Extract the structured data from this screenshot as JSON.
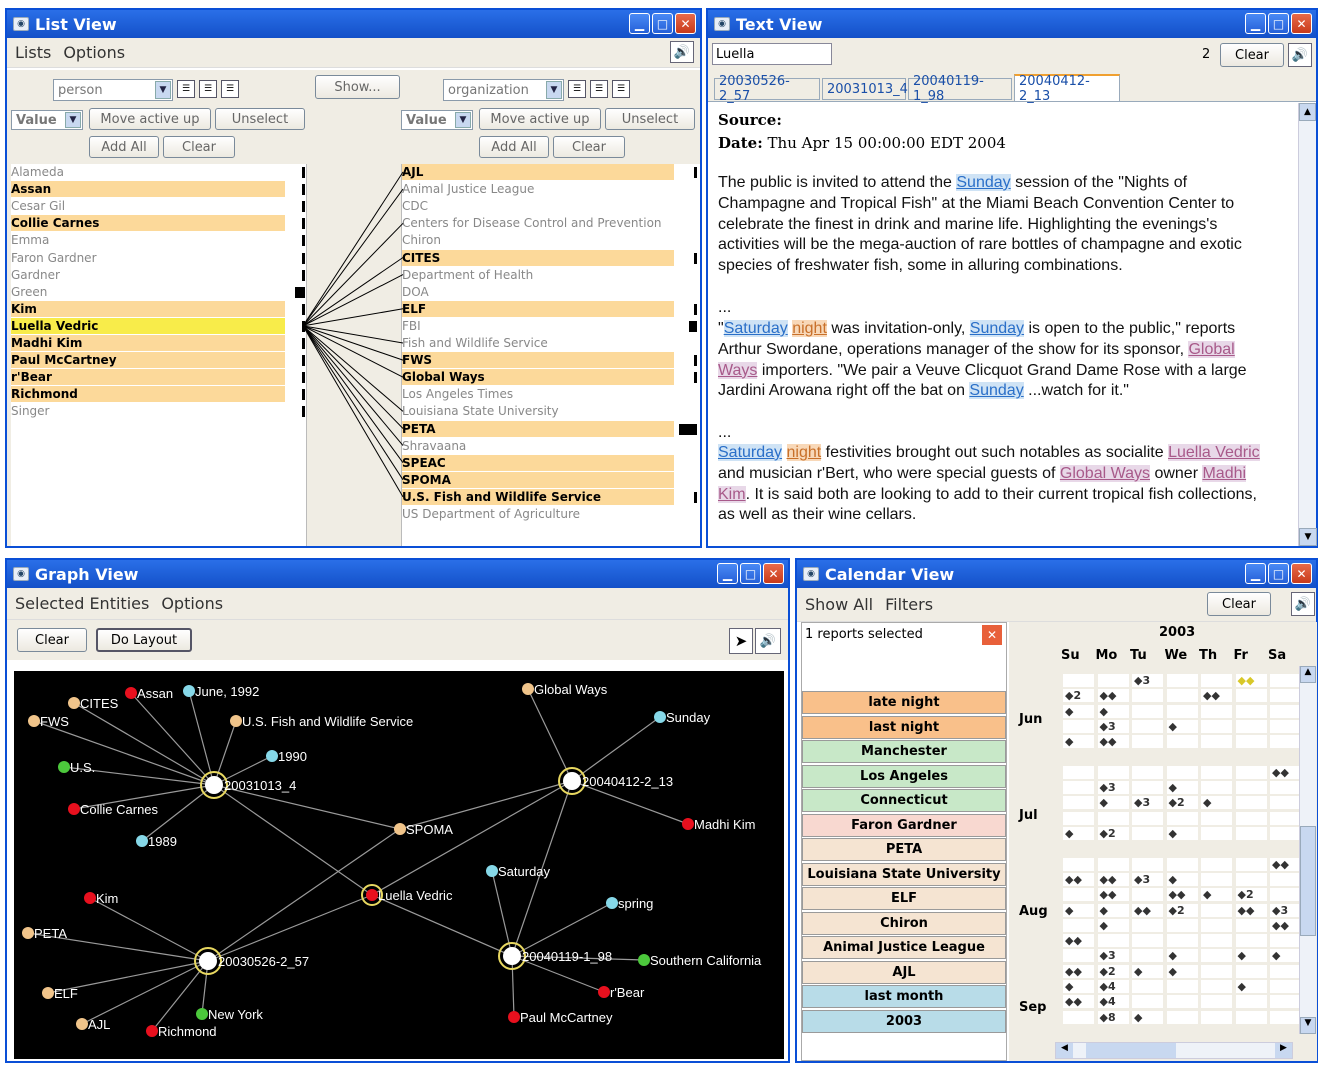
{
  "list_view": {
    "title": "List View",
    "menu": [
      "Lists",
      "Options"
    ],
    "show_button": "Show...",
    "left": {
      "type": "person",
      "value": "Value",
      "move": "Move active up",
      "unselect": "Unselect",
      "add_all": "Add All",
      "clear": "Clear",
      "items": [
        "Alameda",
        "Assan",
        "Cesar Gil",
        "Collie Carnes",
        "Emma",
        "Faron Gardner",
        "Gardner",
        "Green",
        "Kim",
        "Luella Vedric",
        "Madhi Kim",
        "Paul McCartney",
        "r'Bear",
        "Richmond",
        "Singer"
      ]
    },
    "right": {
      "type": "organization",
      "value": "Value",
      "move": "Move active up",
      "unselect": "Unselect",
      "add_all": "Add All",
      "clear": "Clear",
      "items": [
        "AJL",
        "Animal Justice League",
        "CDC",
        "Centers for Disease Control and Prevention",
        "Chiron",
        "CITES",
        "Department of Health",
        "DOA",
        "ELF",
        "FBI",
        "Fish and Wildlife Service",
        "FWS",
        "Global Ways",
        "Los Angeles Times",
        "Louisiana State University",
        "PETA",
        "Shravaana",
        "SPEAC",
        "SPOMA",
        "U.S. Fish and Wildlife Service",
        "US Department of Agriculture"
      ]
    }
  },
  "text_view": {
    "title": "Text View",
    "search": "Luella",
    "count": "2",
    "clear": "Clear",
    "tabs": [
      "20030526-2_57",
      "20031013_4",
      "20040119-1_98",
      "20040412-2_13"
    ],
    "source_label": "Source:",
    "date_label": "Date:",
    "date_value": "Thu Apr 15 00:00:00 EDT 2004",
    "p1": [
      "The public is invited to attend the ",
      "Sunday",
      " session of the \"Nights of Champagne and Tropical Fish\" at the Miami Beach Convention Center to celebrate the finest in drink and marine life. Highlighting the evenings's activities will be the mega-auction of rare bottles of champagne and exotic species of freshwater fish, some in alluring combinations."
    ],
    "ellipsis": "...",
    "p2": [
      "\"",
      "Saturday",
      " ",
      "night",
      " was invitation-only, ",
      "Sunday",
      " is open to the public,\" reports Arthur Swordane, operations manager of the show for its sponsor, ",
      "Global Ways",
      " importers. \"We pair a Veuve Clicquot Grand Dame Rose with a large Jardini Arowana right off the bat on ",
      "Sunday",
      " ...watch for it.\""
    ],
    "p3": [
      "Saturday",
      " ",
      "night",
      " festivities brought out such notables as socialite ",
      "Luella Vedric",
      " and musician r'Bert, who were special guests of ",
      "Global Ways",
      " owner ",
      "Madhi Kim",
      ". It is said both are looking to add to their current tropical fish collections, as well as their wine cellars."
    ]
  },
  "graph_view": {
    "title": "Graph View",
    "menu": [
      "Selected Entities",
      "Options"
    ],
    "clear": "Clear",
    "do_layout": "Do Layout",
    "colors": {
      "person": "#e8101e",
      "org": "#f0c48a",
      "date": "#86d8e8",
      "place": "#4cc83c",
      "doc": "#ffffff"
    },
    "nodes": [
      {
        "label": "CITES",
        "kind": "org"
      },
      {
        "label": "Assan",
        "kind": "person"
      },
      {
        "label": "June, 1992",
        "kind": "date"
      },
      {
        "label": "FWS",
        "kind": "org"
      },
      {
        "label": "U.S. Fish and Wildlife Service",
        "kind": "org"
      },
      {
        "label": "1990",
        "kind": "date"
      },
      {
        "label": "U.S.",
        "kind": "place"
      },
      {
        "label": "20031013_4",
        "kind": "doc"
      },
      {
        "label": "Collie Carnes",
        "kind": "person"
      },
      {
        "label": "1989",
        "kind": "date"
      },
      {
        "label": "SPOMA",
        "kind": "org"
      },
      {
        "label": "Global Ways",
        "kind": "org"
      },
      {
        "label": "Sunday",
        "kind": "date"
      },
      {
        "label": "20040412-2_13",
        "kind": "doc"
      },
      {
        "label": "Madhi Kim",
        "kind": "person"
      },
      {
        "label": "Saturday",
        "kind": "date"
      },
      {
        "label": "Luella Vedric",
        "kind": "person"
      },
      {
        "label": "Kim",
        "kind": "person"
      },
      {
        "label": "PETA",
        "kind": "org"
      },
      {
        "label": "spring",
        "kind": "date"
      },
      {
        "label": "20030526-2_57",
        "kind": "doc"
      },
      {
        "label": "20040119-1_98",
        "kind": "doc"
      },
      {
        "label": "Southern California",
        "kind": "place"
      },
      {
        "label": "ELF",
        "kind": "org"
      },
      {
        "label": "r'Bear",
        "kind": "person"
      },
      {
        "label": "New York",
        "kind": "place"
      },
      {
        "label": "AJL",
        "kind": "org"
      },
      {
        "label": "Richmond",
        "kind": "person"
      },
      {
        "label": "Paul McCartney",
        "kind": "person"
      }
    ]
  },
  "calendar_view": {
    "title": "Calendar View",
    "menu": [
      "Show All",
      "Filters"
    ],
    "clear": "Clear",
    "selected": "1 reports selected",
    "year": "2003",
    "days": [
      "Su",
      "Mo",
      "Tu",
      "We",
      "Th",
      "Fr",
      "Sa"
    ],
    "months": [
      "Jun",
      "Jul",
      "Aug",
      "Sep"
    ],
    "filters": [
      {
        "label": "late night",
        "color": "#f9c08a"
      },
      {
        "label": "last night",
        "color": "#f9c08a"
      },
      {
        "label": "Manchester",
        "color": "#c8e8c8"
      },
      {
        "label": "Los Angeles",
        "color": "#c8e8c8"
      },
      {
        "label": "Connecticut",
        "color": "#c8e8c8"
      },
      {
        "label": "Faron Gardner",
        "color": "#f8d8d0"
      },
      {
        "label": "PETA",
        "color": "#f5e4d2"
      },
      {
        "label": "Louisiana State University",
        "color": "#f5e4d2"
      },
      {
        "label": "ELF",
        "color": "#f5e4d2"
      },
      {
        "label": "Chiron",
        "color": "#f5e4d2"
      },
      {
        "label": "Animal Justice League",
        "color": "#f5e4d2"
      },
      {
        "label": "AJL",
        "color": "#f5e4d2"
      },
      {
        "label": "last month",
        "color": "#b8dce8"
      },
      {
        "label": "2003",
        "color": "#b8dce8"
      }
    ]
  }
}
